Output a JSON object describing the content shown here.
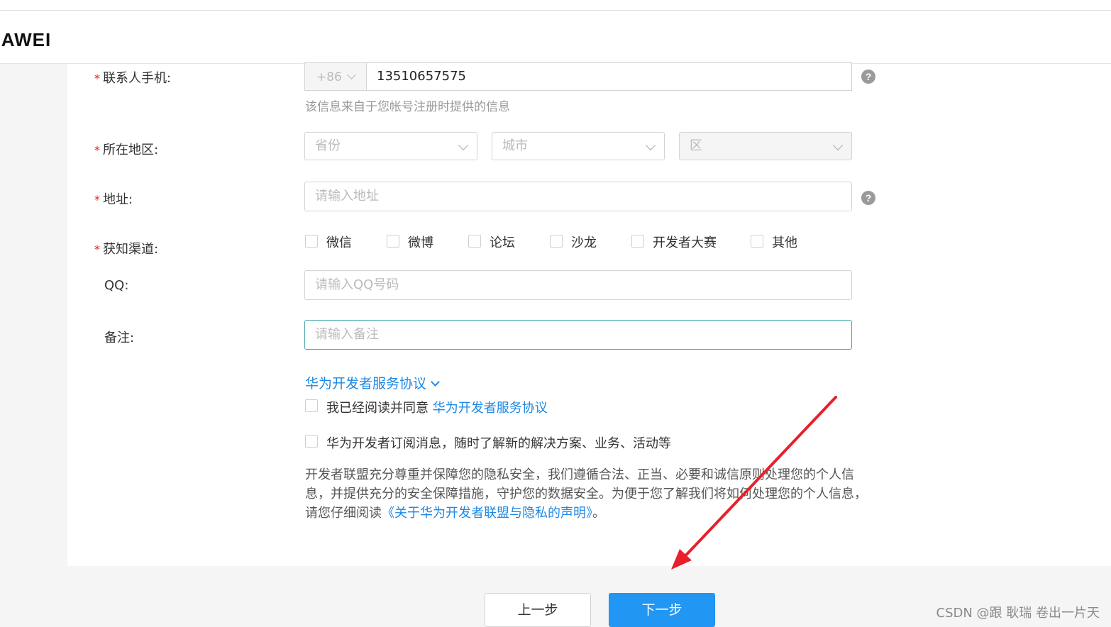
{
  "brand": {
    "logo_text": "UAWEI"
  },
  "form": {
    "phone": {
      "label": "联系人手机:",
      "country_code": "+86",
      "value": "13510657575",
      "hint": "该信息来自于您帐号注册时提供的信息"
    },
    "region": {
      "label": "所在地区:",
      "province_placeholder": "省份",
      "city_placeholder": "城市",
      "district_placeholder": "区"
    },
    "address": {
      "label": "地址:",
      "placeholder": "请输入地址"
    },
    "channel": {
      "label": "获知渠道:",
      "options": [
        "微信",
        "微博",
        "论坛",
        "沙龙",
        "开发者大赛",
        "其他"
      ]
    },
    "qq": {
      "label": "QQ:",
      "placeholder": "请输入QQ号码"
    },
    "remark": {
      "label": "备注:",
      "placeholder": "请输入备注"
    },
    "help_icon_glyph": "?",
    "required_mark": "*"
  },
  "agreement": {
    "toggle_label": "华为开发者服务协议",
    "agree_prefix": "我已经阅读并同意",
    "agree_link": "华为开发者服务协议",
    "subscribe_label": "华为开发者订阅消息，随时了解新的解决方案、业务、活动等"
  },
  "privacy": {
    "text_before": "开发者联盟充分尊重并保障您的隐私安全，我们遵循合法、正当、必要和诚信原则处理您的个人信息，并提供充分的安全保障措施，守护您的数据安全。为便于您了解我们将如何处理您的个人信息，请您仔细阅读",
    "link": "《关于华为开发者联盟与隐私的声明》",
    "text_after": "。"
  },
  "buttons": {
    "prev": "上一步",
    "next": "下一步"
  },
  "watermark": "CSDN @跟 耿瑞 卷出一片天",
  "colors": {
    "primary": "#2196f3",
    "link": "#1e88e5",
    "required": "#e02020",
    "annotation_arrow": "#e8202a"
  }
}
